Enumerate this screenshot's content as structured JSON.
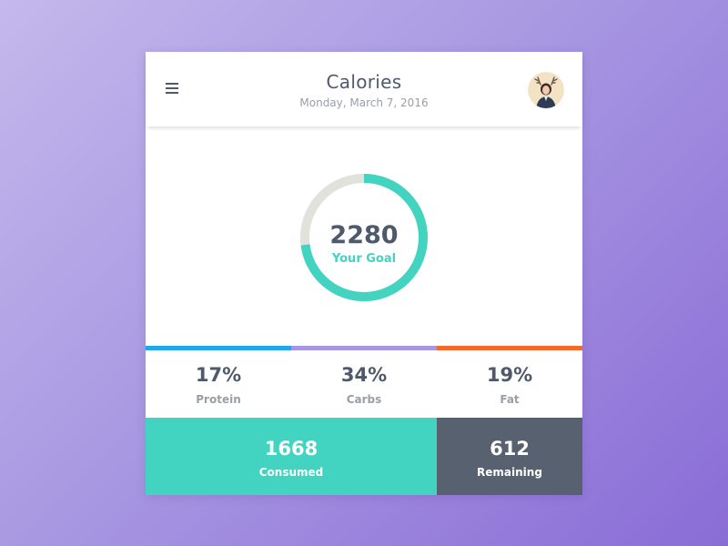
{
  "header": {
    "title": "Calories",
    "date": "Monday, March 7, 2016",
    "menu_icon": "hamburger-menu-icon",
    "avatar_icon": "user-avatar"
  },
  "goal": {
    "value": "2280",
    "label": "Your Goal",
    "progress_fraction": 0.73,
    "ring_fill_color": "#42d4c0",
    "ring_track_color": "#e2e2dc"
  },
  "macros": [
    {
      "value": "17%",
      "label": "Protein",
      "color": "#1fa9e8"
    },
    {
      "value": "34%",
      "label": "Carbs",
      "color": "#a895e0"
    },
    {
      "value": "19%",
      "label": "Fat",
      "color": "#f26b2e"
    }
  ],
  "totals": {
    "consumed": {
      "value": "1668",
      "label": "Consumed",
      "color": "#42d4c0"
    },
    "remaining": {
      "value": "612",
      "label": "Remaining",
      "color": "#58616f"
    }
  }
}
